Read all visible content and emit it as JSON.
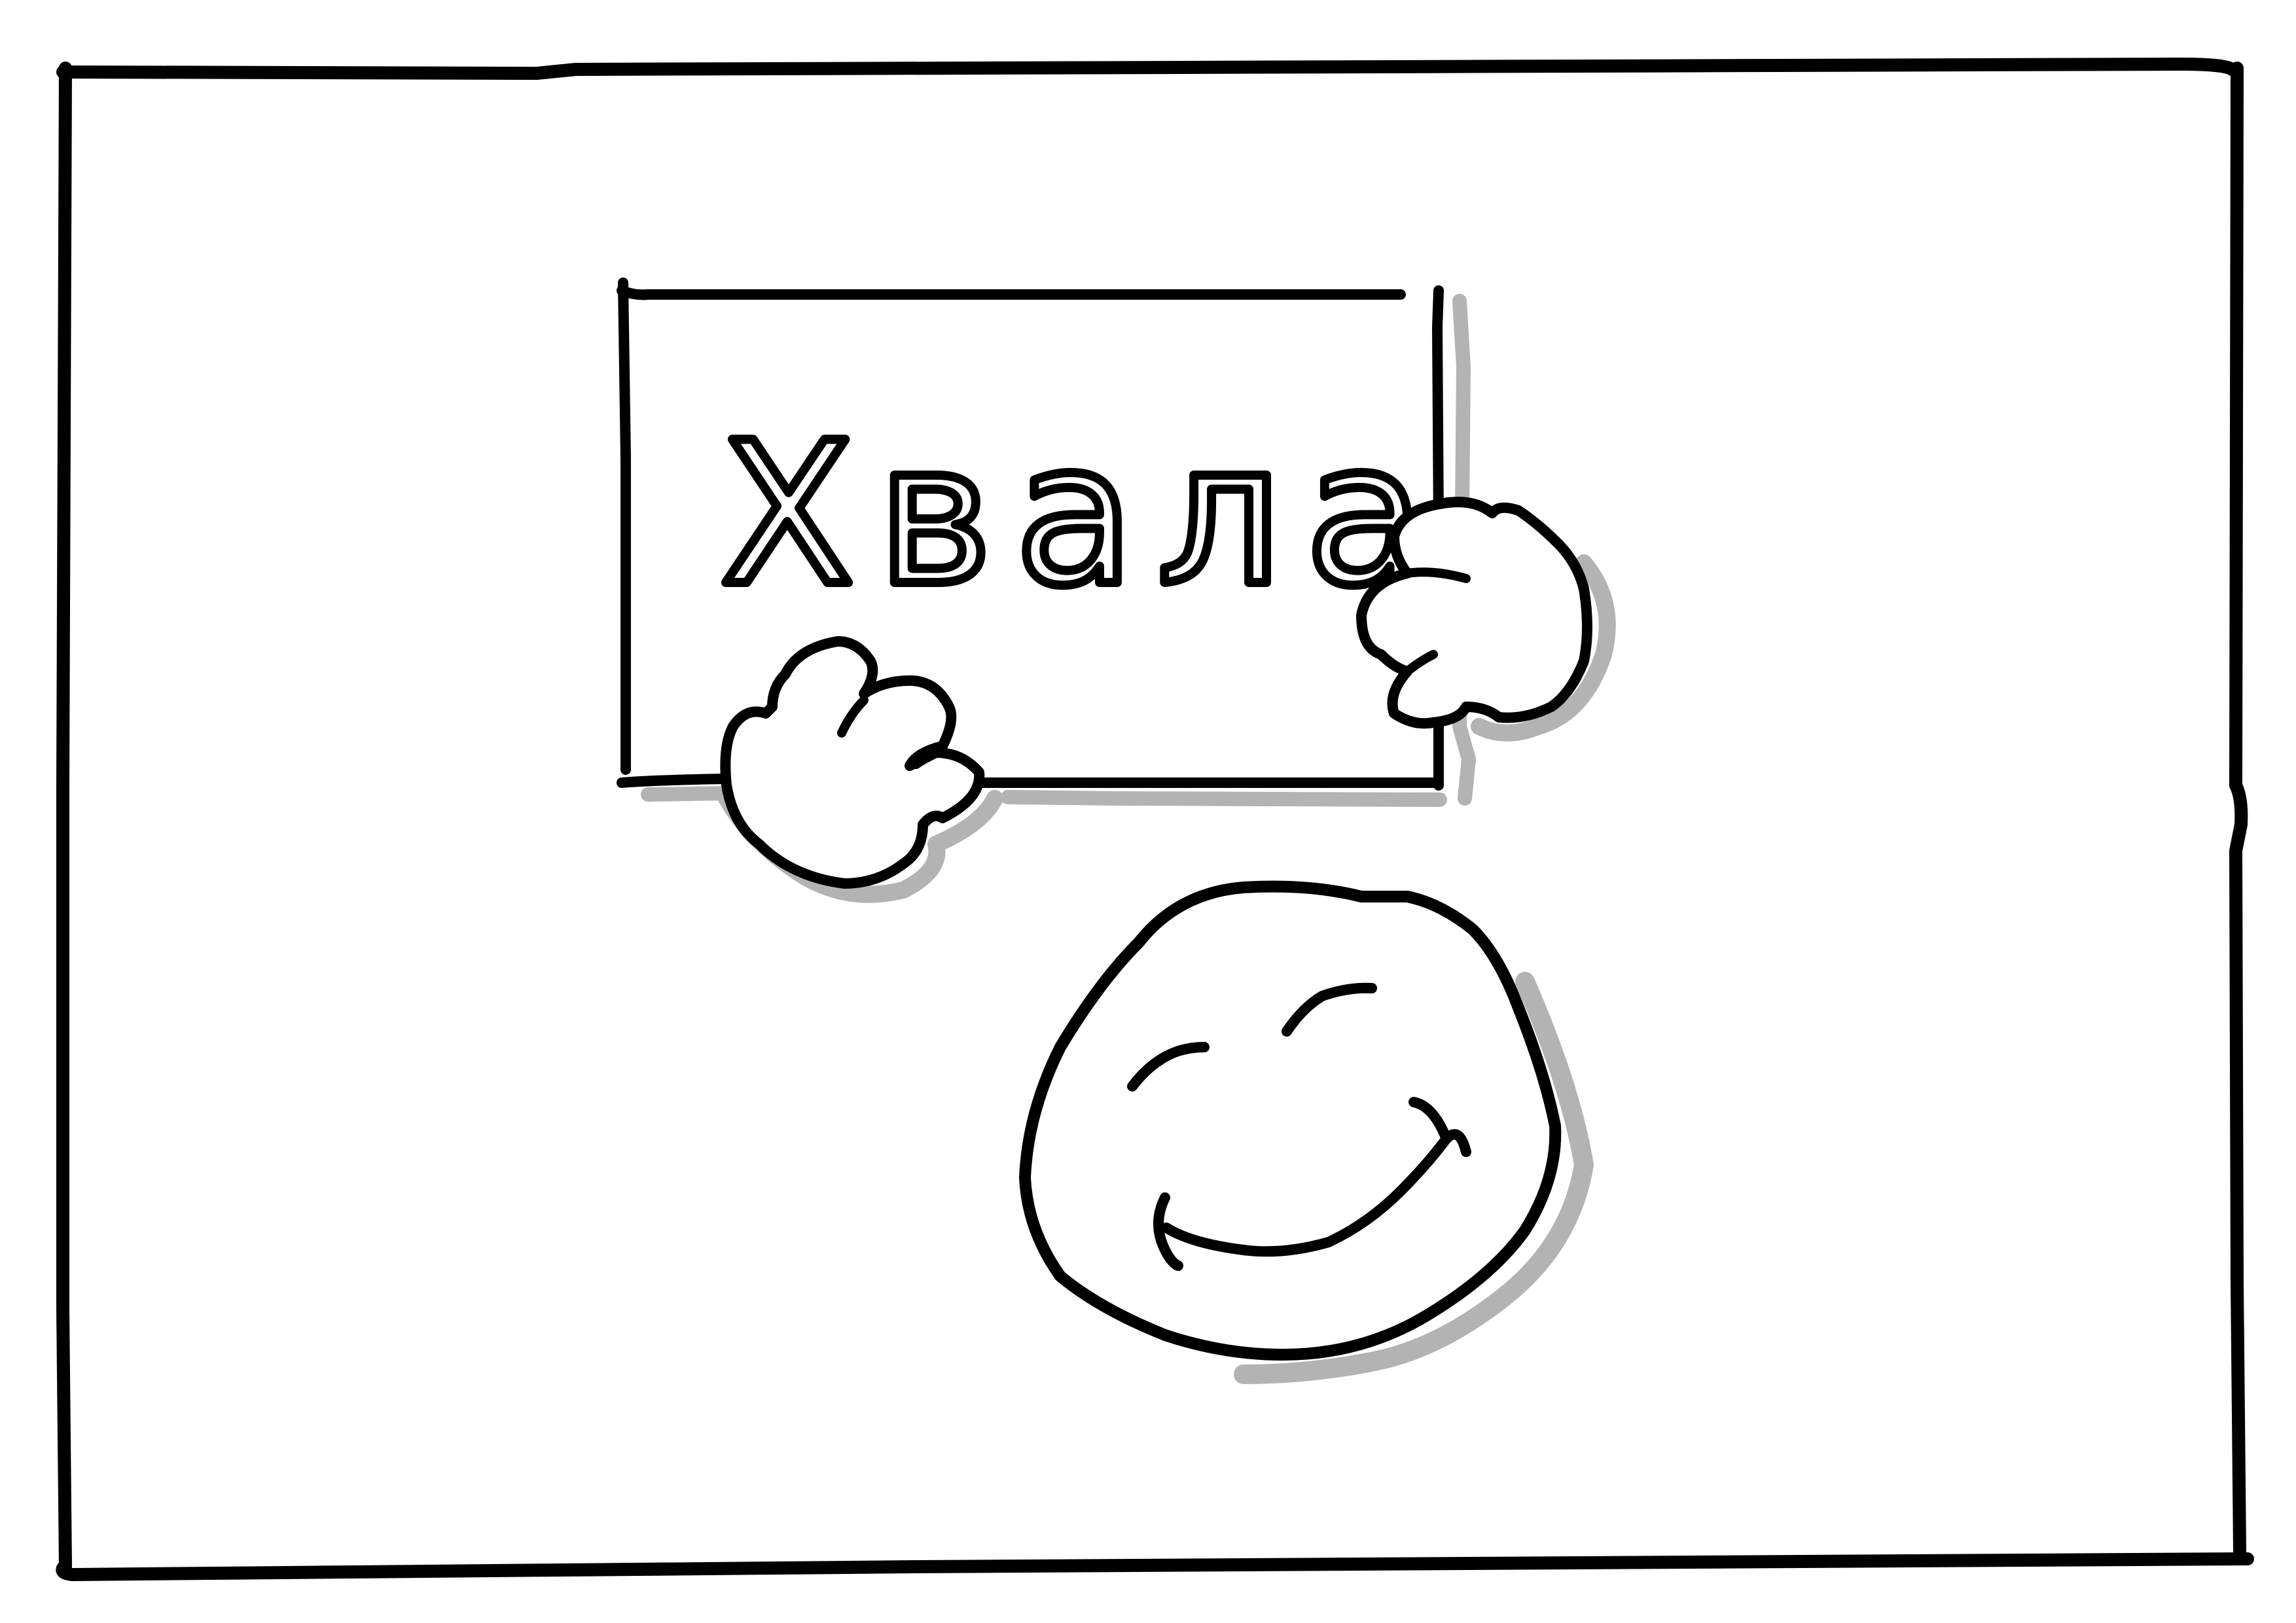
{
  "sign": {
    "text": "Хвала"
  },
  "colors": {
    "ink": "#000000",
    "shadow": "#b3b3b3",
    "paper": "#ffffff"
  }
}
